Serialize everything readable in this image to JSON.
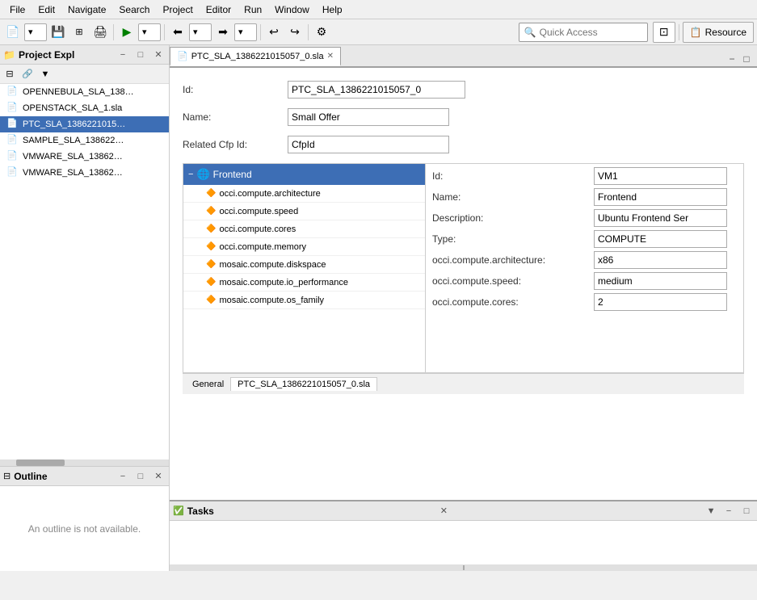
{
  "menubar": {
    "items": [
      "File",
      "Edit",
      "Navigate",
      "Search",
      "Project",
      "Editor",
      "Run",
      "Window",
      "Help"
    ]
  },
  "topbar": {
    "quick_access_placeholder": "Quick Access",
    "quick_access_value": "",
    "resource_label": "Resource"
  },
  "left_panel": {
    "project_explorer": {
      "title": "Project Expl",
      "files": [
        {
          "name": "OPENNEBULA_SLA_138…",
          "selected": false
        },
        {
          "name": "OPENSTACK_SLA_1.sla",
          "selected": false
        },
        {
          "name": "PTC_SLA_1386221015…",
          "selected": true
        },
        {
          "name": "SAMPLE_SLA_138622…",
          "selected": false
        },
        {
          "name": "VMWARE_SLA_13862…",
          "selected": false
        },
        {
          "name": "VMWARE_SLA_13862…",
          "selected": false
        }
      ]
    },
    "outline": {
      "title": "Outline",
      "empty_message": "An outline is not available."
    }
  },
  "editor": {
    "tab_label": "PTC_SLA_1386221015057_0.sla",
    "form": {
      "id_label": "Id:",
      "id_value": "PTC_SLA_1386221015057_0",
      "name_label": "Name:",
      "name_value": "Small Offer",
      "related_cfp_id_label": "Related Cfp Id:",
      "related_cfp_id_value": "CfpId"
    },
    "tree": {
      "root": {
        "label": "Frontend",
        "icon": "globe"
      },
      "children": [
        "occi.compute.architecture",
        "occi.compute.speed",
        "occi.compute.cores",
        "occi.compute.memory",
        "mosaic.compute.diskspace",
        "mosaic.compute.io_performance",
        "mosaic.compute.os_family"
      ]
    },
    "detail": {
      "id_label": "Id:",
      "id_value": "VM1",
      "name_label": "Name:",
      "name_value": "Frontend",
      "description_label": "Description:",
      "description_value": "Ubuntu Frontend Ser",
      "type_label": "Type:",
      "type_value": "COMPUTE",
      "arch_label": "occi.compute.architecture:",
      "arch_value": "x86",
      "speed_label": "occi.compute.speed:",
      "speed_value": "medium",
      "cores_label": "occi.compute.cores:",
      "cores_value": "2"
    },
    "bottom_tabs": [
      "General",
      "PTC_SLA_1386221015057_0.sla"
    ]
  },
  "tasks_panel": {
    "title": "Tasks"
  },
  "icons": {
    "search": "🔍",
    "folder": "📁",
    "file": "📄",
    "globe": "🌐",
    "tree_node": "🔶",
    "minimize": "−",
    "maximize": "□",
    "close": "✕",
    "arrow_down": "▼",
    "arrow_up": "▲",
    "refresh": "↺",
    "collapse": "⊟",
    "expand": "⊞"
  }
}
